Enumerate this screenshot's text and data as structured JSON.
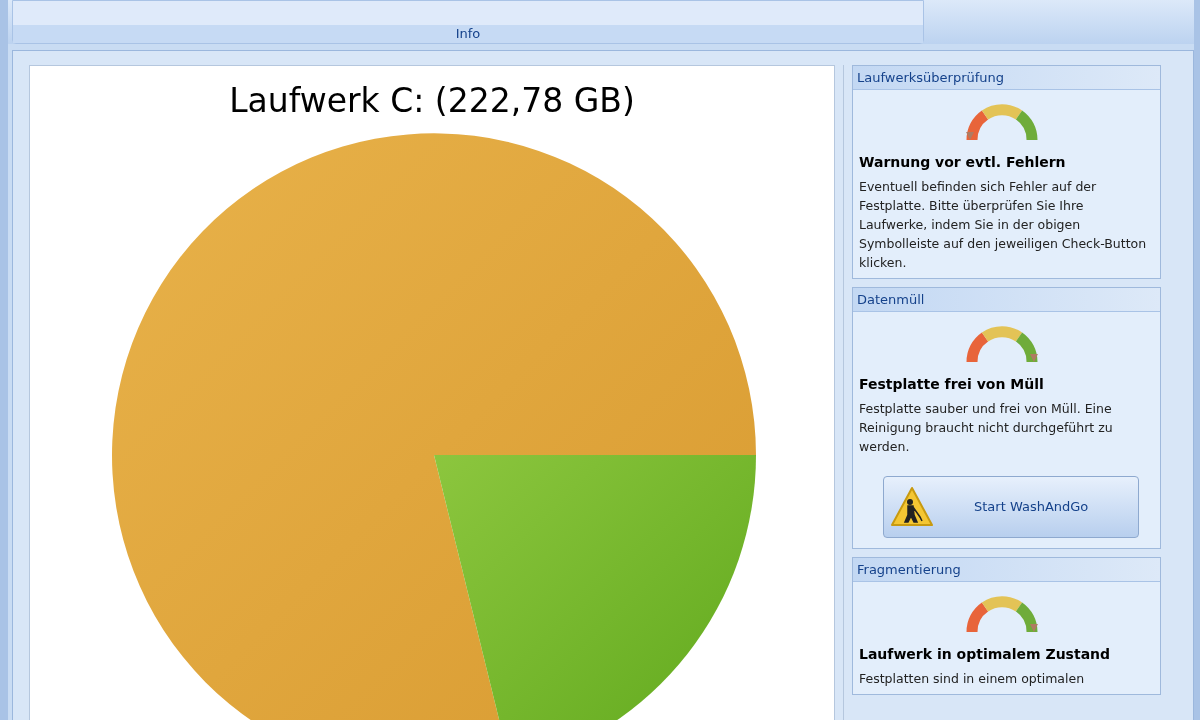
{
  "ribbon": {
    "group_label": "Info"
  },
  "chart": {
    "title": "Laufwerk C: (222,78 GB)"
  },
  "panels": [
    {
      "title": "Laufwerksüberprüfung",
      "level": 0.05,
      "heading": "Warnung vor evtl. Fehlern",
      "text": "Eventuell befinden sich Fehler auf der Festplatte. Bitte überprüfen Sie Ihre Laufwerke, indem Sie in der obigen Symbolleiste auf den jeweiligen Check-Button klicken."
    },
    {
      "title": "Datenmüll",
      "level": 0.95,
      "heading": "Festplatte frei von Müll",
      "text": "Festplatte sauber und frei von Müll. Eine Reinigung braucht nicht durchgeführt zu werden.",
      "button": "Start WashAndGo"
    },
    {
      "title": "Fragmentierung",
      "level": 0.95,
      "heading": "Laufwerk in optimalem Zustand",
      "text": "Festplatten sind in einem optimalen"
    }
  ]
}
